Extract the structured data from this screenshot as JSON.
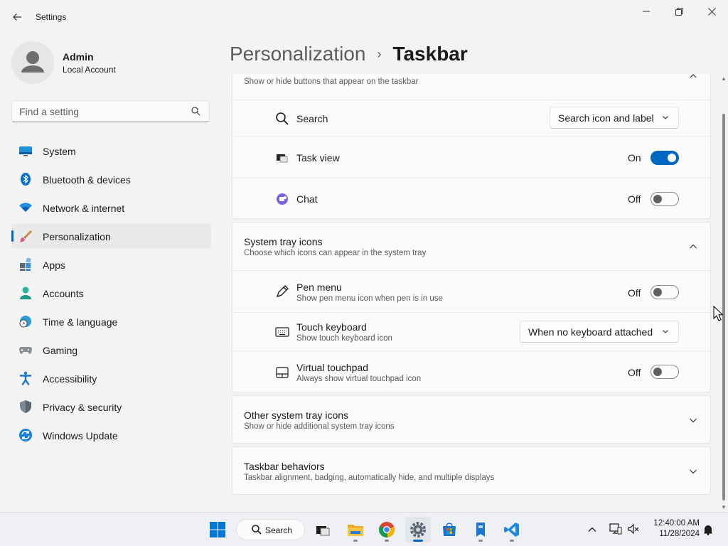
{
  "window": {
    "title": "Settings"
  },
  "profile": {
    "name": "Admin",
    "account": "Local Account"
  },
  "search": {
    "placeholder": "Find a setting"
  },
  "nav": [
    {
      "label": "System",
      "icon": "monitor-icon"
    },
    {
      "label": "Bluetooth & devices",
      "icon": "bluetooth-icon"
    },
    {
      "label": "Network & internet",
      "icon": "wifi-icon"
    },
    {
      "label": "Personalization",
      "icon": "brush-icon",
      "active": true
    },
    {
      "label": "Apps",
      "icon": "apps-icon"
    },
    {
      "label": "Accounts",
      "icon": "person-icon"
    },
    {
      "label": "Time & language",
      "icon": "globe-clock-icon"
    },
    {
      "label": "Gaming",
      "icon": "gamepad-icon"
    },
    {
      "label": "Accessibility",
      "icon": "accessibility-icon"
    },
    {
      "label": "Privacy & security",
      "icon": "shield-icon"
    },
    {
      "label": "Windows Update",
      "icon": "update-icon"
    }
  ],
  "breadcrumb": {
    "parent": "Personalization",
    "separator": "›",
    "current": "Taskbar"
  },
  "taskbar_items": {
    "subtitle": "Show or hide buttons that appear on the taskbar",
    "search": {
      "label": "Search",
      "value": "Search icon and label"
    },
    "task_view": {
      "label": "Task view",
      "state": "On"
    },
    "chat": {
      "label": "Chat",
      "state": "Off"
    }
  },
  "system_tray": {
    "title": "System tray icons",
    "subtitle": "Choose which icons can appear in the system tray",
    "pen": {
      "label": "Pen menu",
      "sub": "Show pen menu icon when pen is in use",
      "state": "Off"
    },
    "touch_keyboard": {
      "label": "Touch keyboard",
      "sub": "Show touch keyboard icon",
      "value": "When no keyboard attached"
    },
    "touchpad": {
      "label": "Virtual touchpad",
      "sub": "Always show virtual touchpad icon",
      "state": "Off"
    }
  },
  "other_tray": {
    "title": "Other system tray icons",
    "subtitle": "Show or hide additional system tray icons"
  },
  "behaviors": {
    "title": "Taskbar behaviors",
    "subtitle": "Taskbar alignment, badging, automatically hide, and multiple displays"
  },
  "taskbar": {
    "search_label": "Search",
    "time": "12:40:00 AM",
    "date": "11/28/2024"
  },
  "colors": {
    "accent": "#0067c0",
    "background": "#f3f3f3",
    "card": "#fbfbfb"
  }
}
